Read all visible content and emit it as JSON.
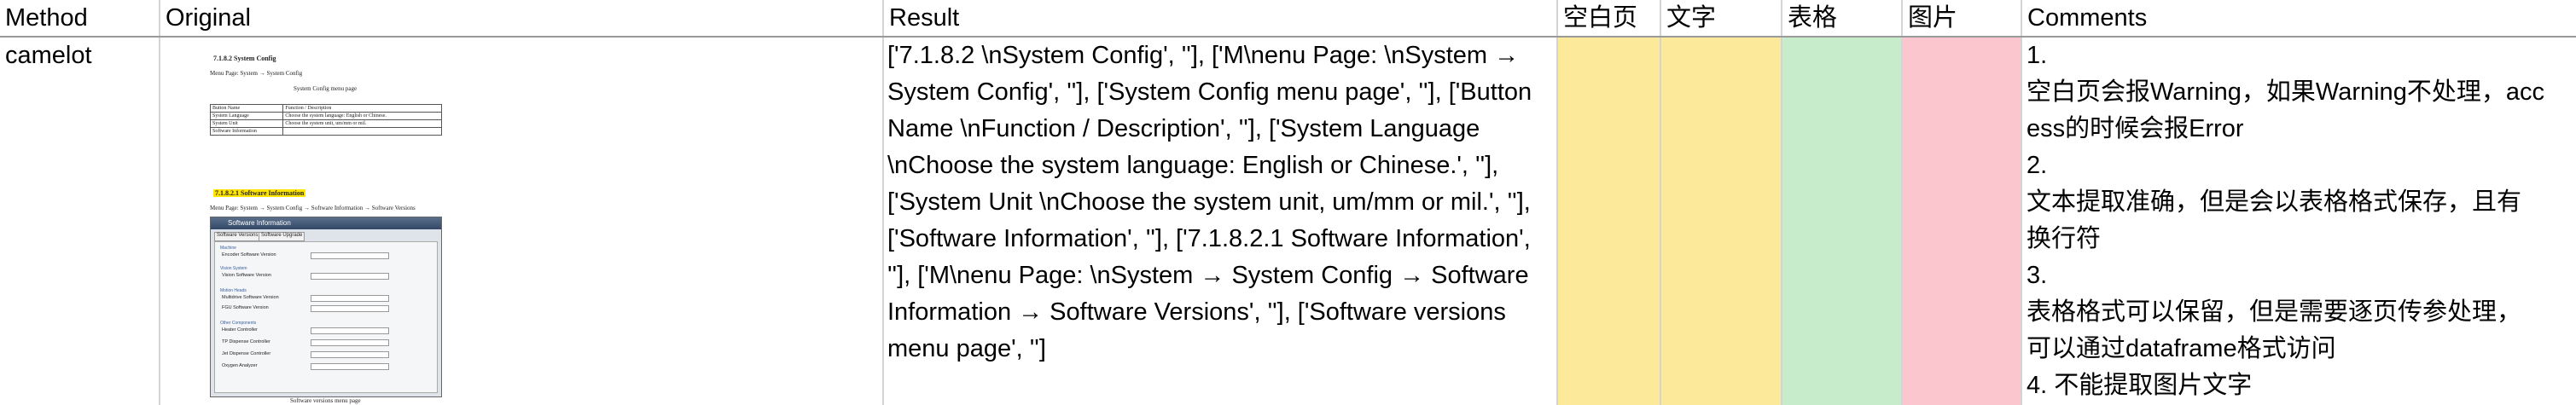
{
  "header": {
    "method": "Method",
    "original": "Original",
    "result": "Result",
    "blank_page": "空白页",
    "text": "文字",
    "table": "表格",
    "image": "图片",
    "comments": "Comments"
  },
  "row": {
    "method": "camelot",
    "result_lines": [
      "['7.1.8.2 \\nSystem Config', ''], ['M\\nenu Page: \\nSystem →",
      "System Config', ''], ['System Config menu page', ''], ['Button",
      "Name \\nFunction / Description', ''], ['System Language",
      "\\nChoose the system language: English or Chinese.', ''],",
      "['System Unit \\nChoose the system unit, um/mm or mil.', ''],",
      "['Software Information', ''], ['7.1.8.2.1 Software Information',",
      "''], ['M\\nenu Page: \\nSystem → System Config → Software",
      "Information → Software Versions', ''], ['Software versions",
      "menu page', '']"
    ],
    "comment_lines": [
      "1.",
      "空白页会报Warning，如果Warning不处理，acc",
      "ess的时候会报Error",
      "2.",
      "文本提取准确，但是会以表格格式保存，且有",
      "换行符",
      "3.",
      "表格格式可以保留，但是需要逐页传参处理，",
      "可以通过dataframe格式访问",
      "4. 不能提取图片文字"
    ],
    "colors": {
      "blank_page": "#fde99a",
      "text": "#fde99a",
      "table": "#c7eccb",
      "image": "#fbc6ce"
    }
  },
  "thumbnail": {
    "section_title": "7.1.8.2   System Config",
    "menu_path": "Menu Page:    System → System Config",
    "menu_caption": "System Config menu page",
    "table_rows": [
      [
        "Button Name",
        "Function / Description"
      ],
      [
        "System Language",
        "Choose the system language: English or Chinese."
      ],
      [
        "System Unit",
        "Choose the system unit, um/mm or mil."
      ],
      [
        "Software Information",
        ""
      ]
    ],
    "subsection_title": "7.1.8.2.1 Software Information",
    "sub_menu_path": "Menu Page:    System → System Config → Software Information → Software Versions",
    "dialog_title": "Software Information",
    "tabs": [
      "Software Versions",
      "Software Upgrade"
    ],
    "groups": [
      "Machine",
      "Vision System",
      "Motion Heads",
      "Other Components"
    ],
    "fields": [
      "Encoder Software Version",
      "Vision Software Version",
      "Multidrive Software Version",
      "FGU Software Version",
      "Heater Controller",
      "TP Dispense Controller",
      "Jet Dispense Controller",
      "Oxygen Analyzer"
    ],
    "caption": "Software versions menu page"
  }
}
